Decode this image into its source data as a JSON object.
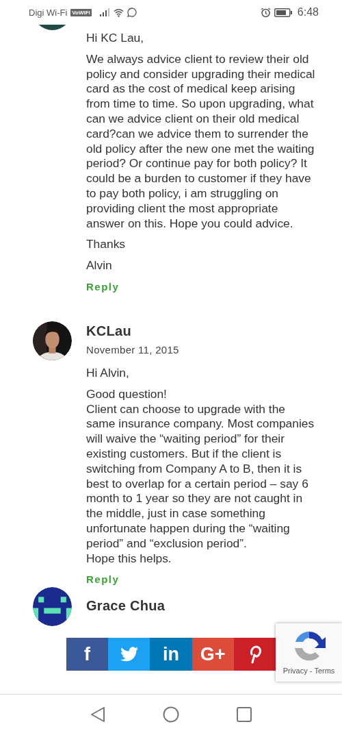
{
  "status_bar": {
    "carrier": "Digi Wi-Fi",
    "vowifi_badge": "VoWiFi",
    "time": "6:48"
  },
  "comments": [
    {
      "kind": "continued",
      "greeting": "Hi KC Lau,",
      "paragraphs": [
        "We always advice client to review their old policy and consider upgrading their medical card as the cost of medical keep arising from time to time. So upon upgrading, what can we advice client on their old medical card?can we advice them to surrender the old policy after the new one met the waiting period? Or continue pay for both policy? It could be a burden to customer if they have to pay both policy, i am struggling on providing client the most appropriate answer on this. Hope you could advice.",
        "Thanks",
        "Alvin"
      ],
      "reply_link": "Reply"
    },
    {
      "kind": "full",
      "author": "KCLau",
      "date": "November 11, 2015",
      "greeting": "Hi Alvin,",
      "paragraphs": [
        "Good question!\nClient can choose to upgrade with the same insurance company. Most companies will waive the “waiting period” for their existing customers. But if the client is switching from Company A to B, then it is best to overlap for a certain period – say 6 month to 1 year so they are not caught in the middle, just in case something unfortunate happen during the “waiting period” and “exclusion period”.\nHope this helps."
      ],
      "reply_link": "Reply"
    },
    {
      "kind": "header",
      "author": "Grace Chua"
    }
  ],
  "share_bar": [
    {
      "kind": "facebook",
      "label": "f",
      "color": "#3b5998"
    },
    {
      "kind": "twitter",
      "color": "#1da1f2"
    },
    {
      "kind": "linkedin",
      "label": "in",
      "color": "#0077b5"
    },
    {
      "kind": "googleplus",
      "label": "G+",
      "color": "#dd4b39"
    },
    {
      "kind": "pinterest",
      "color": "#cb2027"
    }
  ],
  "recaptcha": {
    "links": [
      "Privacy",
      "Terms"
    ],
    "separator": "-"
  }
}
